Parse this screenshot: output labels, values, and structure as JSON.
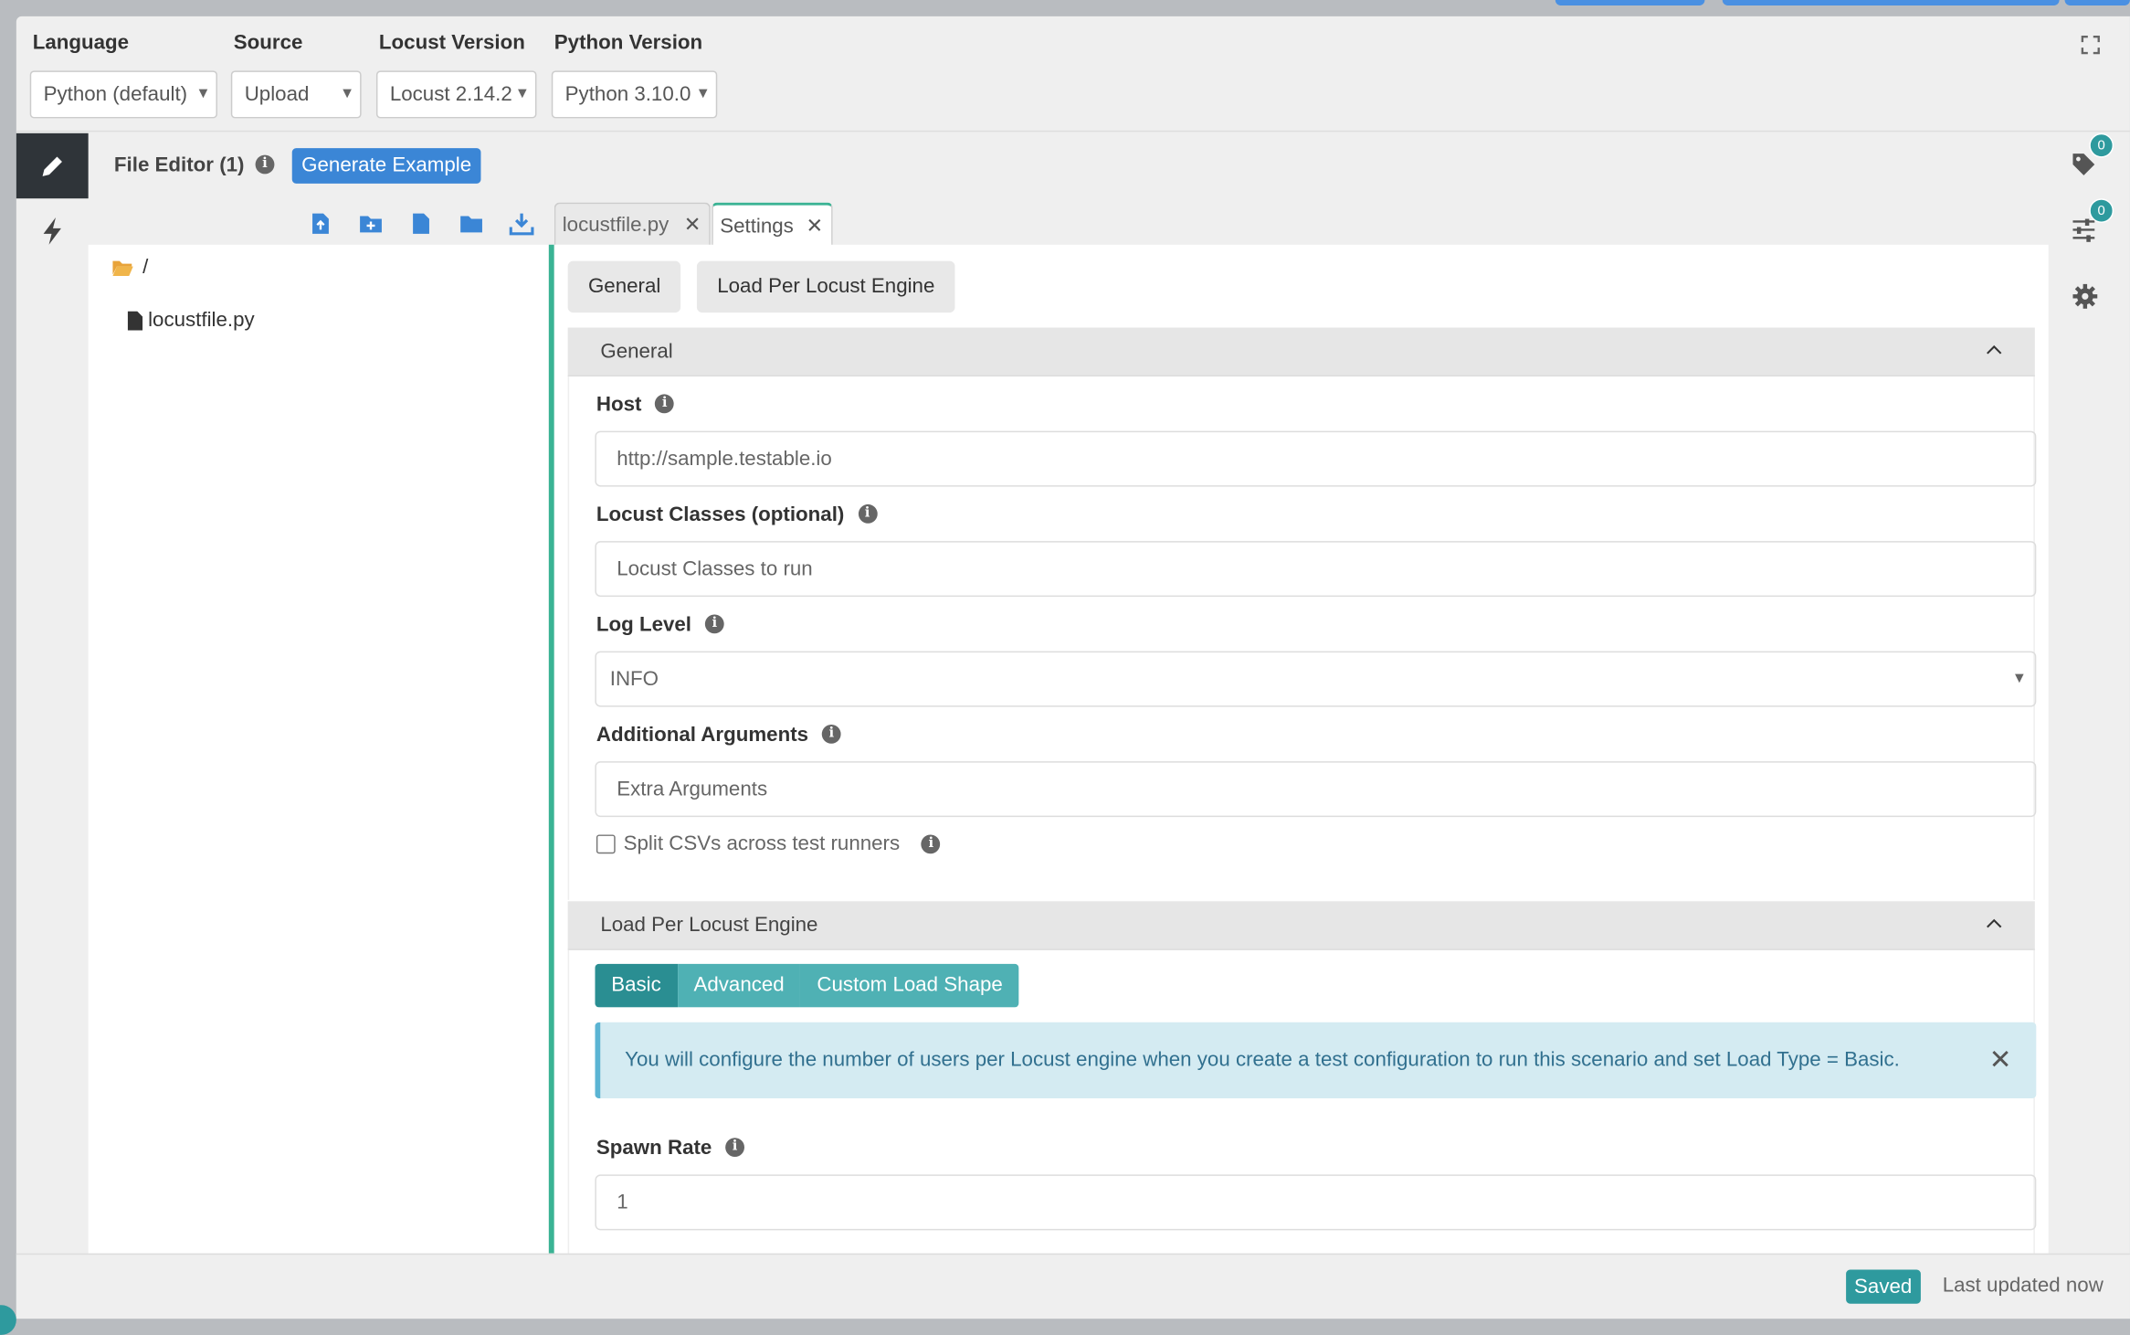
{
  "header": {
    "language": {
      "label": "Language",
      "value": "Python (default)"
    },
    "source": {
      "label": "Source",
      "value": "Upload"
    },
    "locust_version": {
      "label": "Locust Version",
      "value": "Locust 2.14.2"
    },
    "python_version": {
      "label": "Python Version",
      "value": "Python 3.10.0"
    }
  },
  "file_editor": {
    "title": "File Editor (1)",
    "generate_label": "Generate Example"
  },
  "tree": {
    "root": "/",
    "files": [
      "locustfile.py"
    ]
  },
  "tabs": [
    {
      "label": "locustfile.py"
    },
    {
      "label": "Settings"
    }
  ],
  "settings": {
    "pills": [
      "General",
      "Load Per Locust Engine"
    ],
    "general": {
      "title": "General",
      "host": {
        "label": "Host",
        "placeholder": "http://sample.testable.io"
      },
      "locust_classes": {
        "label": "Locust Classes (optional)",
        "placeholder": "Locust Classes to run"
      },
      "log_level": {
        "label": "Log Level",
        "value": "INFO"
      },
      "additional_args": {
        "label": "Additional Arguments",
        "placeholder": "Extra Arguments"
      },
      "split_csv": {
        "label": "Split CSVs across test runners",
        "checked": false
      }
    },
    "load": {
      "title": "Load Per Locust Engine",
      "modes": [
        "Basic",
        "Advanced",
        "Custom Load Shape"
      ],
      "active_mode": "Basic",
      "alert": "You will configure the number of users per Locust engine when you create a test configuration to run this scenario and set Load Type = Basic.",
      "spawn_rate": {
        "label": "Spawn Rate",
        "value": "1"
      }
    }
  },
  "right_nav": {
    "tags_count": "0",
    "params_count": "0"
  },
  "footer": {
    "status": "Saved",
    "updated": "Last updated now"
  },
  "colors": {
    "accent": "#3ab394",
    "primary": "#3b86d6",
    "teal": "#2e9a9e",
    "info_bg": "#d4ebf2"
  }
}
